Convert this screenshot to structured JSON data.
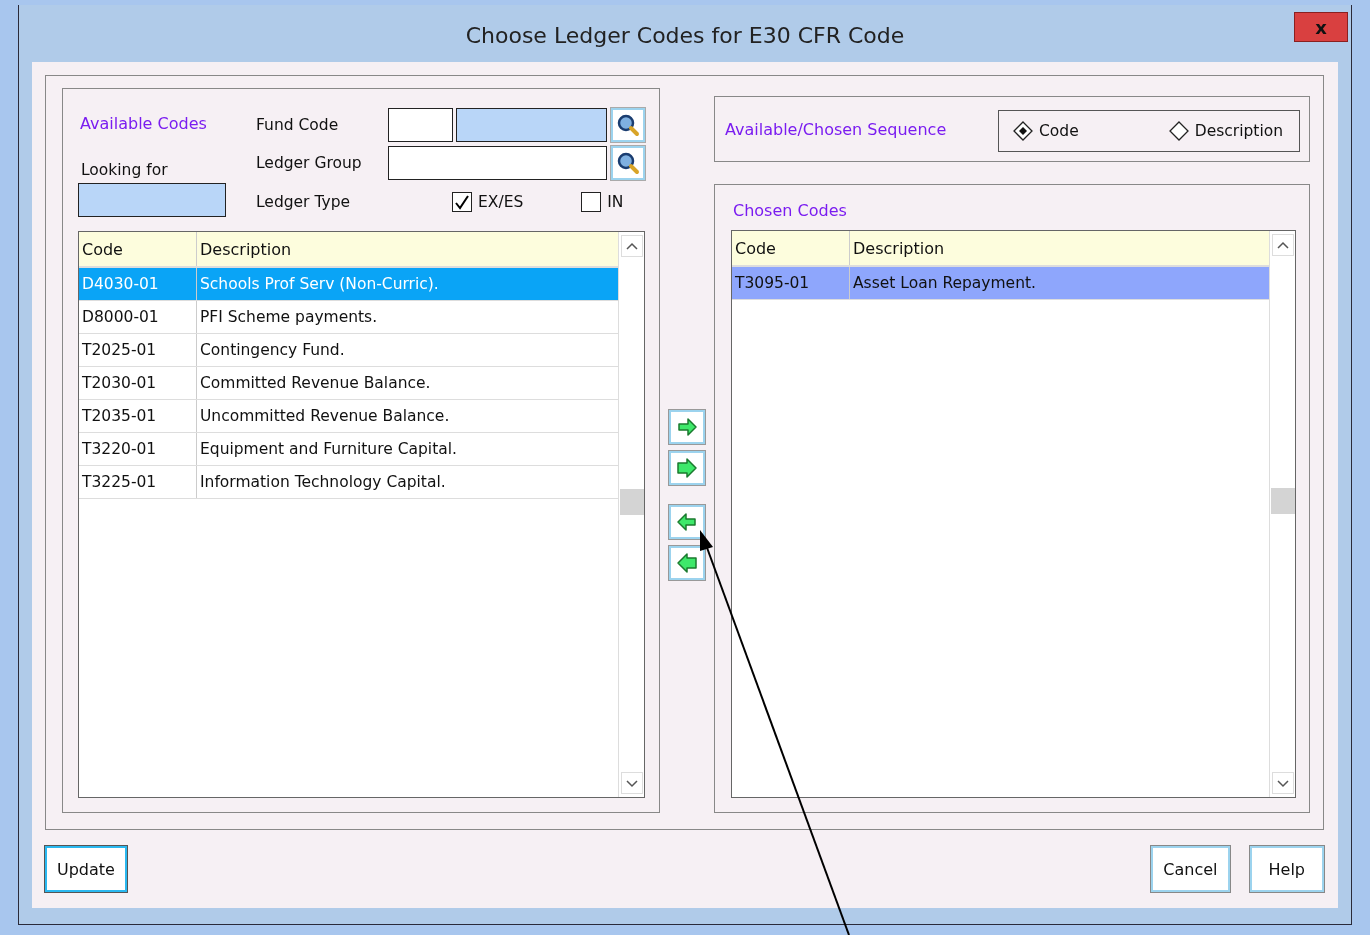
{
  "window": {
    "title": "Choose Ledger Codes for E30 CFR Code",
    "close_label": "x"
  },
  "available": {
    "title": "Available Codes",
    "looking_for_label": "Looking for",
    "fund_code_label": "Fund Code",
    "ledger_group_label": "Ledger Group",
    "ledger_type_label": "Ledger Type",
    "ledger_types": [
      {
        "label": "EX/ES",
        "checked": true
      },
      {
        "label": "IN",
        "checked": false
      }
    ],
    "columns": [
      "Code",
      "Description"
    ],
    "rows": [
      {
        "code": "D4030-01",
        "description": "Schools Prof Serv (Non-Curric).",
        "selected": true
      },
      {
        "code": "D8000-01",
        "description": "PFI Scheme payments.",
        "selected": false
      },
      {
        "code": "T2025-01",
        "description": "Contingency Fund.",
        "selected": false
      },
      {
        "code": "T2030-01",
        "description": "Committed Revenue Balance.",
        "selected": false
      },
      {
        "code": "T2035-01",
        "description": "Uncommitted Revenue Balance.",
        "selected": false
      },
      {
        "code": "T3220-01",
        "description": "Equipment and Furniture Capital.",
        "selected": false
      },
      {
        "code": "T3225-01",
        "description": "Information Technology Capital.",
        "selected": false
      }
    ]
  },
  "transfer_buttons": [
    {
      "kind": "right"
    },
    {
      "kind": "rightwide"
    },
    {
      "kind": "left"
    },
    {
      "kind": "leftwide"
    }
  ],
  "sequence": {
    "title": "Available/Chosen Sequence",
    "options": [
      {
        "label": "Code",
        "selected": true
      },
      {
        "label": "Description",
        "selected": false
      }
    ]
  },
  "chosen": {
    "title": "Chosen Codes",
    "columns": [
      "Code",
      "Description"
    ],
    "rows": [
      {
        "code": "T3095-01",
        "description": "Asset Loan Repayment.",
        "selected": true
      }
    ]
  },
  "buttons": [
    {
      "label": "Update",
      "focused": true
    },
    {
      "label": "Cancel",
      "focused": false
    },
    {
      "label": "Help",
      "focused": false
    }
  ]
}
